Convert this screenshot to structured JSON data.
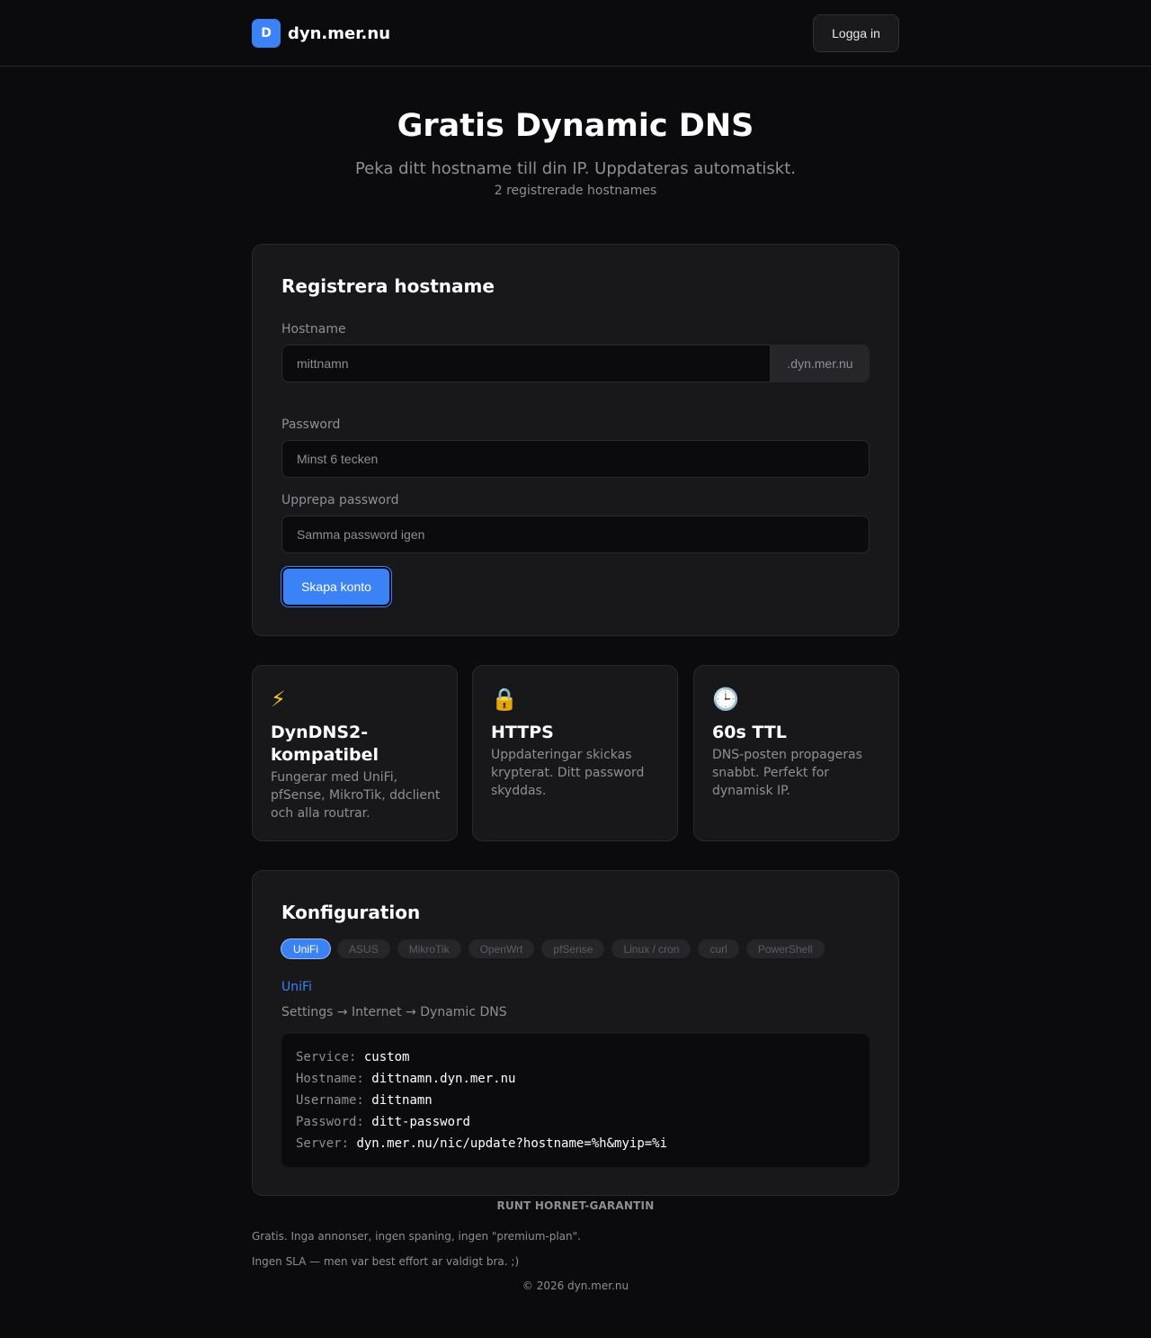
{
  "header": {
    "logo_letter": "D",
    "brand": "dyn.mer.nu",
    "login_label": "Logga in"
  },
  "hero": {
    "title": "Gratis Dynamic DNS",
    "subtitle": "Peka ditt hostname till din IP. Uppdateras automatiskt.",
    "count": "2 registrerade hostnames"
  },
  "register": {
    "title": "Registrera hostname",
    "hostname_label": "Hostname",
    "hostname_placeholder": "mittnamn",
    "hostname_suffix": ".dyn.mer.nu",
    "password_label": "Password",
    "password_placeholder": "Minst 6 tecken",
    "repeat_label": "Upprepa password",
    "repeat_placeholder": "Samma password igen",
    "submit_label": "Skapa konto"
  },
  "features": [
    {
      "icon": "lightning-icon",
      "glyph": "⚡",
      "title": "DynDNS2-kompatibel",
      "text": "Fungerar med UniFi, pfSense, MikroTik, ddclient och alla routrar."
    },
    {
      "icon": "lock-icon",
      "glyph": "🔒",
      "title": "HTTPS",
      "text": "Uppdateringar skickas krypterat. Ditt password skyddas."
    },
    {
      "icon": "clock-icon",
      "glyph": "🕒",
      "title": "60s TTL",
      "text": "DNS-posten propageras snabbt. Perfekt for dynamisk IP."
    }
  ],
  "config": {
    "title": "Konfiguration",
    "tabs": [
      "UniFi",
      "ASUS",
      "MikroTik",
      "OpenWrt",
      "pfSense",
      "Linux / cron",
      "curl",
      "PowerShell"
    ],
    "active_tab": "UniFi",
    "heading": "UniFi",
    "path": "Settings → Internet → Dynamic DNS",
    "code": [
      {
        "key": "Service:",
        "value": "custom"
      },
      {
        "key": "Hostname:",
        "value": "dittnamn.dyn.mer.nu"
      },
      {
        "key": "Username:",
        "value": "dittnamn"
      },
      {
        "key": "Password:",
        "value": "ditt-password"
      },
      {
        "key": "Server:",
        "value": "dyn.mer.nu/nic/update?hostname=%h&myip=%i"
      }
    ]
  },
  "footer": {
    "title": "RUNT HORNET-GARANTIN",
    "line1": "Gratis. Inga annonser, ingen spaning, ingen \"premium-plan\".",
    "line2": "Ingen SLA — men var best effort ar valdigt bra. ;)",
    "copyright": "© 2026 dyn.mer.nu"
  },
  "colors": {
    "accent": "#3b82f6",
    "background": "#0b0b0d",
    "card": "#18181b",
    "muted_text": "#8e8e95"
  }
}
